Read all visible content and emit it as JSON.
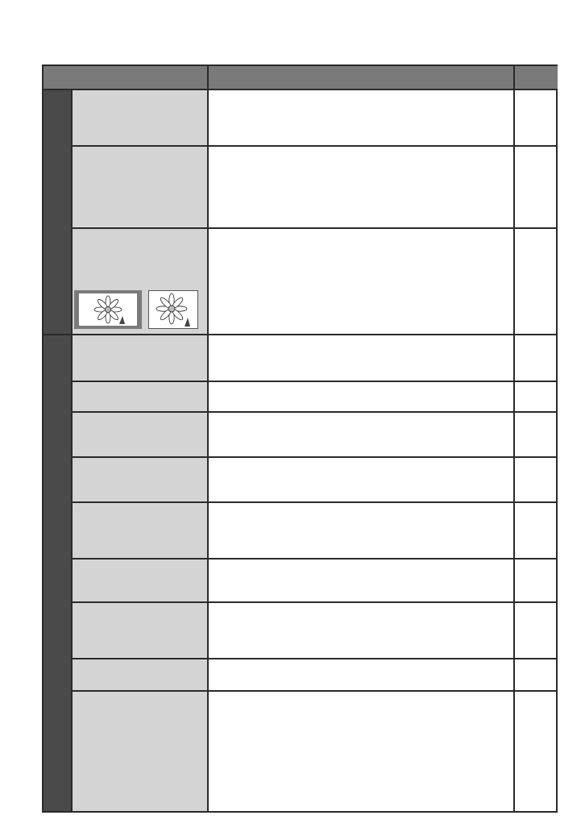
{
  "document": {
    "header": {
      "col1": "",
      "col2": "",
      "col3": ""
    },
    "icons": {
      "thumbnail_left": "flower-thumbnail-framed",
      "thumbnail_right": "flower-thumbnail-plain"
    },
    "colors": {
      "header_bg": "#7a7a7a",
      "side_bg": "#4a4a4a",
      "name_cell_bg": "#d4d4d4",
      "border": "#2a2a2a"
    }
  }
}
